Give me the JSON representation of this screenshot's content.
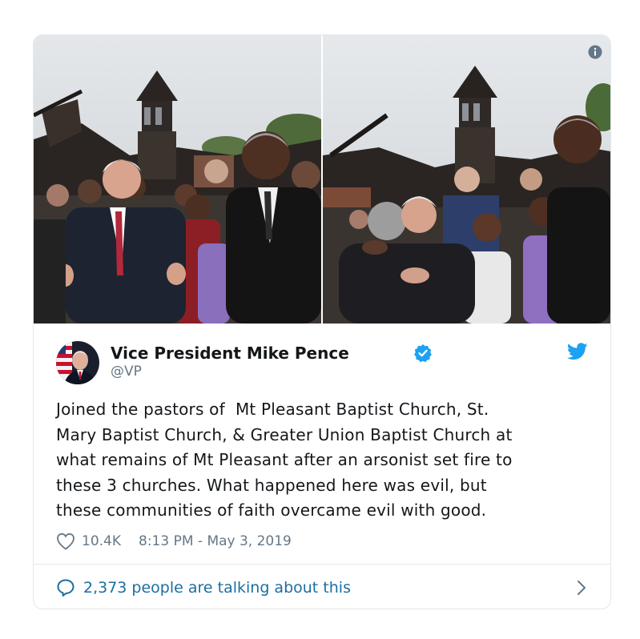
{
  "tweet": {
    "author_name": "Vice President Mike Pence",
    "author_handle": "@VP",
    "text": "Joined the pastors of  Mt Pleasant Baptist Church, St.\nMary Baptist Church, & Greater Union Baptist Church at\nwhat remains of Mt Pleasant after an arsonist set fire to\nthese 3 churches. What happened here was evil, but\nthese communities of faith overcame evil with good.",
    "likes": "10.4K",
    "timestamp": "8:13 PM - May 3, 2019"
  },
  "footer": {
    "talking_label": "2,373 people are talking about this"
  },
  "icons": {
    "info": "info-icon",
    "verified": "verified-badge-icon",
    "twitter": "twitter-bird-icon",
    "like": "heart-icon",
    "reply": "speech-bubble-icon",
    "chevron": "chevron-right-icon"
  },
  "colors": {
    "twitter_blue": "#1da1f2",
    "link_blue": "#1b6ea1",
    "secondary_text": "#657786",
    "border": "#e1e8ed"
  }
}
